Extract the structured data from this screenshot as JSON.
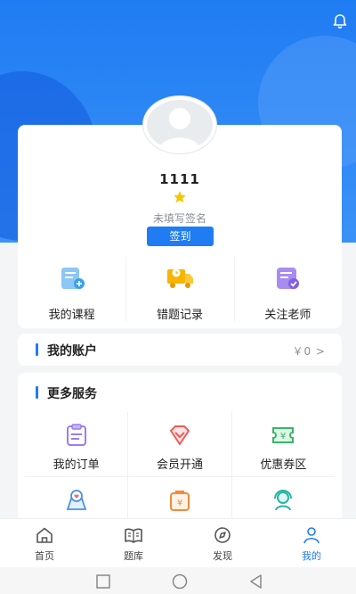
{
  "profile": {
    "username": "1111",
    "signature": "未填写签名",
    "signin_label": "签到"
  },
  "quick_actions": [
    {
      "label": "我的课程",
      "icon": "course-icon"
    },
    {
      "label": "错题记录",
      "icon": "mistakes-truck-icon"
    },
    {
      "label": "关注老师",
      "icon": "follow-teacher-icon"
    }
  ],
  "account": {
    "title": "我的账户",
    "value": "￥0 >"
  },
  "services": {
    "title": "更多服务",
    "items": [
      {
        "label": "我的订单",
        "icon": "order-icon"
      },
      {
        "label": "会员开通",
        "icon": "member-diamond-icon"
      },
      {
        "label": "优惠券区",
        "icon": "coupon-icon"
      },
      {
        "label": "",
        "icon": "chat-location-icon"
      },
      {
        "label": "",
        "icon": "wallet-icon"
      },
      {
        "label": "",
        "icon": "customer-service-icon"
      }
    ]
  },
  "tabbar": {
    "items": [
      {
        "label": "首页",
        "icon": "home-icon"
      },
      {
        "label": "题库",
        "icon": "question-bank-icon"
      },
      {
        "label": "发现",
        "icon": "discover-icon"
      },
      {
        "label": "我的",
        "icon": "user-icon",
        "active": true
      }
    ]
  },
  "colors": {
    "primary": "#1f7cf2",
    "background": "#f4f5f7"
  }
}
